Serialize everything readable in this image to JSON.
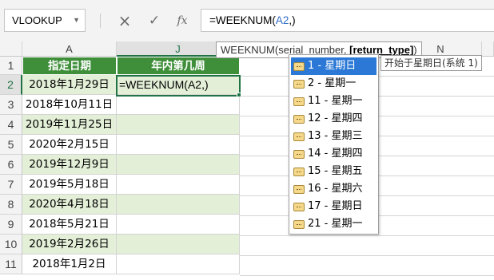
{
  "formula_bar": {
    "name_box": "VLOOKUP",
    "cancel_icon": "×",
    "enter_icon": "✓",
    "function_icon": "fx",
    "formula_prefix": "=WEEKNUM(",
    "formula_ref": "A2",
    "formula_suffix": ",)"
  },
  "columns": {
    "A": "A",
    "J": "J",
    "N": "N"
  },
  "rows": [
    "1",
    "2",
    "3",
    "4",
    "5",
    "6",
    "7",
    "8",
    "9",
    "10",
    "11"
  ],
  "table": {
    "header_a": "指定日期",
    "header_j": "年内第几周",
    "dates": [
      "2018年1月29日",
      "2018年10月11日",
      "2019年11月25日",
      "2020年2月15日",
      "2019年12月9日",
      "2019年5月18日",
      "2020年4月18日",
      "2018年5月21日",
      "2019年2月26日",
      "2018年1月2日"
    ],
    "editing_cell": "=WEEKNUM(A2,)"
  },
  "tooltip": {
    "prefix": "WEEKNUM(serial_number, ",
    "current_arg": "[return_type]",
    "suffix": ")"
  },
  "dropdown": {
    "items": [
      "1 - 星期日",
      "2 - 星期一",
      "11 - 星期一",
      "12 - 星期四",
      "13 - 星期三",
      "14 - 星期四",
      "15 - 星期五",
      "16 - 星期六",
      "17 - 星期日",
      "21 - 星期一"
    ],
    "selected_index": 0
  },
  "item_description": "开始于星期日(系统 1)",
  "colors": {
    "header_green": "#3f8f3a",
    "band_green": "#e3efd7",
    "selection_green": "#217346",
    "list_highlight": "#2b78d6"
  }
}
